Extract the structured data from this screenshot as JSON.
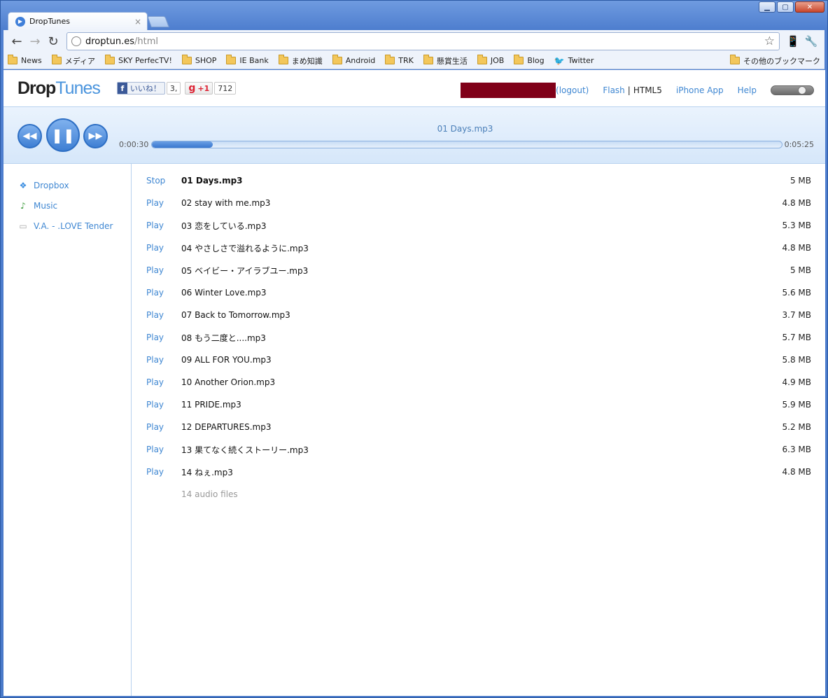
{
  "browser": {
    "tab_title": "DropTunes",
    "tab_close": "×",
    "url_host": "droptun.es",
    "url_path": "/html",
    "bookmarks": [
      "News",
      "メディア",
      "SKY PerfecTV!",
      "SHOP",
      "IE Bank",
      "まめ知識",
      "Android",
      "TRK",
      "懸賞生活",
      "JOB",
      "Blog",
      "Twitter"
    ],
    "bookmarks_other": "その他のブックマーク"
  },
  "header": {
    "logo_drop": "Drop",
    "logo_tunes": "Tunes",
    "fb_label": "いいね！",
    "fb_count": "3,",
    "gplus_label": "+1",
    "gplus_count": "712",
    "logout": "(logout)",
    "flash": "Flash",
    "separator": "|",
    "html5": "HTML5",
    "iphone_app": "iPhone App",
    "help": "Help"
  },
  "player": {
    "now_playing": "01 Days.mp3",
    "current_time": "0:00:30",
    "total_time": "0:05:25",
    "progress": 0.097
  },
  "sidebar": {
    "items": [
      {
        "label": "Dropbox",
        "icon": "dropbox-icon"
      },
      {
        "label": "Music",
        "icon": "music-icon"
      },
      {
        "label": "V.A. - .LOVE Tender",
        "icon": "folder-icon"
      }
    ]
  },
  "files": [
    {
      "action": "Stop",
      "name": "01 Days.mp3",
      "size": "5 MB",
      "playing": true
    },
    {
      "action": "Play",
      "name": "02 stay with me.mp3",
      "size": "4.8 MB"
    },
    {
      "action": "Play",
      "name": "03 恋をしている.mp3",
      "size": "5.3 MB"
    },
    {
      "action": "Play",
      "name": "04 やさしさで溢れるように.mp3",
      "size": "4.8 MB"
    },
    {
      "action": "Play",
      "name": "05 ベイビー・アイラブユー.mp3",
      "size": "5 MB"
    },
    {
      "action": "Play",
      "name": "06 Winter Love.mp3",
      "size": "5.6 MB"
    },
    {
      "action": "Play",
      "name": "07 Back to Tomorrow.mp3",
      "size": "3.7 MB"
    },
    {
      "action": "Play",
      "name": "08 もう二度と....mp3",
      "size": "5.7 MB"
    },
    {
      "action": "Play",
      "name": "09 ALL FOR YOU.mp3",
      "size": "5.8 MB"
    },
    {
      "action": "Play",
      "name": "10 Another Orion.mp3",
      "size": "4.9 MB"
    },
    {
      "action": "Play",
      "name": "11 PRIDE.mp3",
      "size": "5.9 MB"
    },
    {
      "action": "Play",
      "name": "12 DEPARTURES.mp3",
      "size": "5.2 MB"
    },
    {
      "action": "Play",
      "name": "13 果てなく続くストーリー.mp3",
      "size": "6.3 MB"
    },
    {
      "action": "Play",
      "name": "14 ねぇ.mp3",
      "size": "4.8 MB"
    }
  ],
  "summary": "14 audio files",
  "colors": {
    "accent": "#3f87d2",
    "redacted": "#800018"
  }
}
